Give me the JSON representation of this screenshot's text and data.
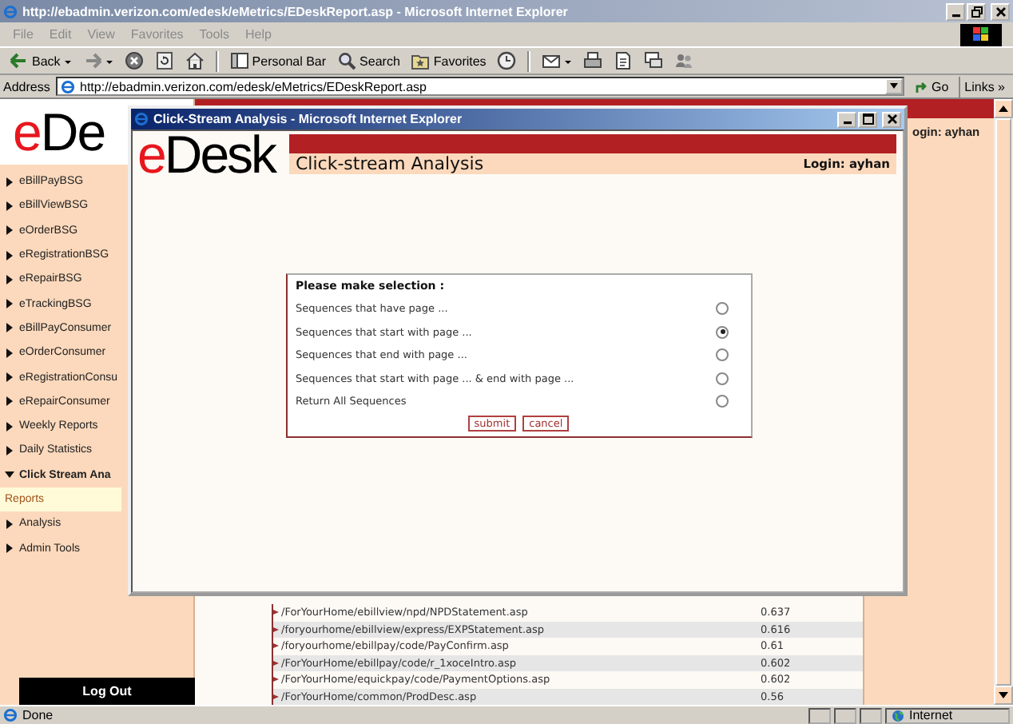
{
  "browser": {
    "title": "http://ebadmin.verizon.com/edesk/eMetrics/EDeskReport.asp - Microsoft Internet Explorer",
    "menu": [
      "File",
      "Edit",
      "View",
      "Favorites",
      "Tools",
      "Help"
    ],
    "toolbar": [
      {
        "kind": "back",
        "label": "Back"
      },
      {
        "kind": "forward"
      },
      {
        "kind": "stop"
      },
      {
        "kind": "refresh"
      },
      {
        "kind": "home"
      },
      {
        "kind": "personal",
        "label": "Personal Bar"
      },
      {
        "kind": "search",
        "label": "Search"
      },
      {
        "kind": "favorites",
        "label": "Favorites"
      },
      {
        "kind": "history"
      },
      {
        "kind": "mail"
      },
      {
        "kind": "print"
      },
      {
        "kind": "edit"
      },
      {
        "kind": "discuss"
      },
      {
        "kind": "messenger"
      }
    ],
    "address": {
      "label": "Address",
      "value": "http://ebadmin.verizon.com/edesk/eMetrics/EDeskReport.asp",
      "go": "Go",
      "links": "Links »"
    }
  },
  "page": {
    "logo": {
      "accent": "e",
      "rest": "De"
    },
    "login": "ogin: ayhan",
    "sidebar": [
      {
        "kind": "section",
        "label": "eBillPayBSG",
        "expanded": false,
        "selected": false
      },
      {
        "kind": "section",
        "label": "eBillViewBSG",
        "expanded": false,
        "selected": false
      },
      {
        "kind": "section",
        "label": "eOrderBSG",
        "expanded": false,
        "selected": false
      },
      {
        "kind": "section",
        "label": "eRegistrationBSG",
        "expanded": false,
        "selected": false
      },
      {
        "kind": "section",
        "label": "eRepairBSG",
        "expanded": false,
        "selected": false
      },
      {
        "kind": "section",
        "label": "eTrackingBSG",
        "expanded": false,
        "selected": false
      },
      {
        "kind": "section",
        "label": "eBillPayConsumer",
        "expanded": false,
        "selected": false
      },
      {
        "kind": "section",
        "label": "eOrderConsumer",
        "expanded": false,
        "selected": false
      },
      {
        "kind": "section",
        "label": "eRegistrationConsu",
        "expanded": false,
        "selected": false
      },
      {
        "kind": "section",
        "label": "eRepairConsumer",
        "expanded": false,
        "selected": false
      },
      {
        "kind": "section",
        "label": "Weekly Reports",
        "expanded": false,
        "selected": false
      },
      {
        "kind": "section",
        "label": "Daily Statistics",
        "expanded": false,
        "selected": false
      },
      {
        "kind": "section",
        "label": "Click Stream Ana",
        "expanded": true,
        "selected": false
      },
      {
        "kind": "link",
        "label": "Reports",
        "selected": true
      },
      {
        "kind": "section",
        "label": "Analysis",
        "expanded": false,
        "selected": false
      },
      {
        "kind": "section",
        "label": "Admin Tools",
        "expanded": false,
        "selected": false
      }
    ],
    "logout": "Log Out",
    "table": {
      "rows": [
        {
          "path": "/ForYourHome/ebillview/npd/NPDStatement.asp",
          "value": "0.637"
        },
        {
          "path": "/foryourhome/ebillview/express/EXPStatement.asp",
          "value": "0.616"
        },
        {
          "path": "/foryourhome/ebillpay/code/PayConfirm.asp",
          "value": "0.61"
        },
        {
          "path": "/ForYourHome/ebillpay/code/r_1xoceIntro.asp",
          "value": "0.602"
        },
        {
          "path": "/ForYourHome/equickpay/code/PaymentOptions.asp",
          "value": "0.602"
        },
        {
          "path": "/ForYourHome/common/ProdDesc.asp",
          "value": "0.56"
        }
      ]
    }
  },
  "popup": {
    "title": "Click-Stream Analysis - Microsoft Internet Explorer",
    "logo": {
      "accent": "e",
      "rest": "Desk"
    },
    "heading": "Click-stream Analysis",
    "login": "Login: ayhan",
    "form": {
      "title": "Please make selection :",
      "options": [
        {
          "label": "Sequences that have page ...",
          "selected": false
        },
        {
          "label": "Sequences that start with page ...",
          "selected": true
        },
        {
          "label": "Sequences that end with page ...",
          "selected": false
        },
        {
          "label": "Sequences that start with page ... & end with page ...",
          "selected": false
        },
        {
          "label": "Return All Sequences",
          "selected": false
        }
      ],
      "buttons": [
        "submit",
        "cancel"
      ]
    }
  },
  "status": {
    "text": "Done",
    "zone": "Internet"
  }
}
